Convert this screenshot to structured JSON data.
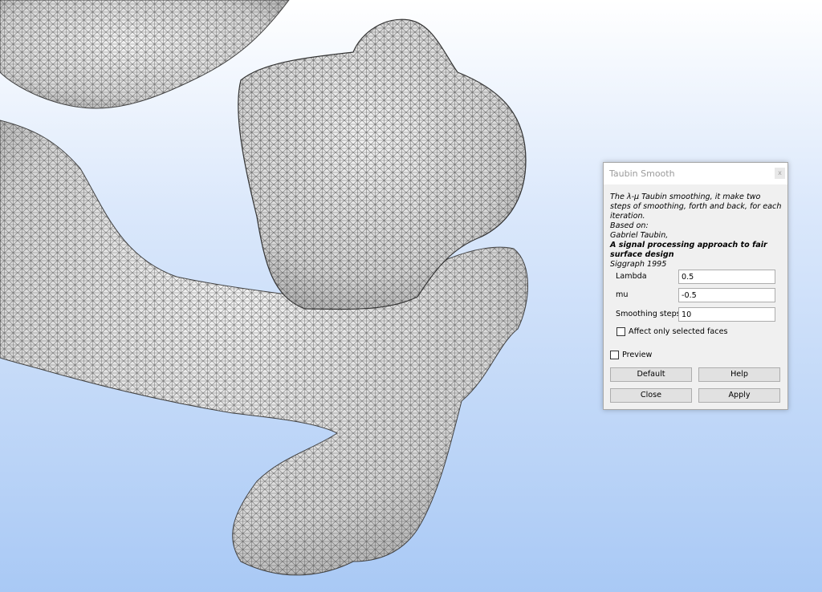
{
  "dialog": {
    "title": "Taubin Smooth",
    "close_glyph": "x",
    "description": {
      "line1": "The λ-μ Taubin smoothing, it make two steps of smoothing, forth and back, for each iteration.",
      "based_on": "Based on:",
      "author": "Gabriel Taubin,",
      "paper": "A signal processing approach to fair surface design",
      "venue": "Siggraph 1995"
    },
    "fields": {
      "lambda": {
        "label": "Lambda",
        "value": "0.5"
      },
      "mu": {
        "label": "mu",
        "value": "-0.5"
      },
      "steps": {
        "label": "Smoothing steps",
        "value": "10"
      }
    },
    "affect_selected": {
      "label": "Affect only selected faces",
      "checked": false
    },
    "preview": {
      "label": "Preview",
      "checked": false
    },
    "buttons": {
      "default": "Default",
      "help": "Help",
      "close": "Close",
      "apply": "Apply"
    }
  },
  "viewport": {
    "mesh_fill": "#e9e9e9",
    "mesh_edge": "#3a3a3a",
    "background_top": "#ffffff",
    "background_bottom": "#a9c9f5"
  }
}
